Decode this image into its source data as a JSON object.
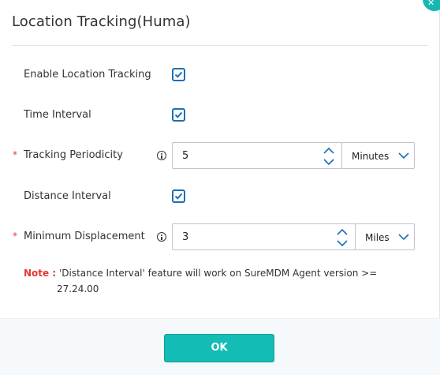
{
  "dialog": {
    "title": "Location Tracking(Huma)",
    "close_icon": "close-icon"
  },
  "fields": {
    "enable_location_tracking": {
      "label": "Enable Location Tracking",
      "checked": true
    },
    "time_interval": {
      "label": "Time Interval",
      "checked": true
    },
    "tracking_periodicity": {
      "label": "Tracking Periodicity",
      "required_marker": "*",
      "value": "5",
      "unit": "Minutes"
    },
    "distance_interval": {
      "label": "Distance Interval",
      "checked": true
    },
    "minimum_displacement": {
      "label": "Minimum Displacement",
      "required_marker": "*",
      "value": "3",
      "unit": "Miles"
    }
  },
  "note": {
    "label": "Note :",
    "text_line1": "'Distance Interval' feature will work on SureMDM Agent version >=",
    "text_line2": "27.24.00"
  },
  "footer": {
    "ok_label": "OK"
  },
  "colors": {
    "accent": "#13bdb5",
    "checkbox": "#1c6fb4",
    "required": "#e53935"
  }
}
